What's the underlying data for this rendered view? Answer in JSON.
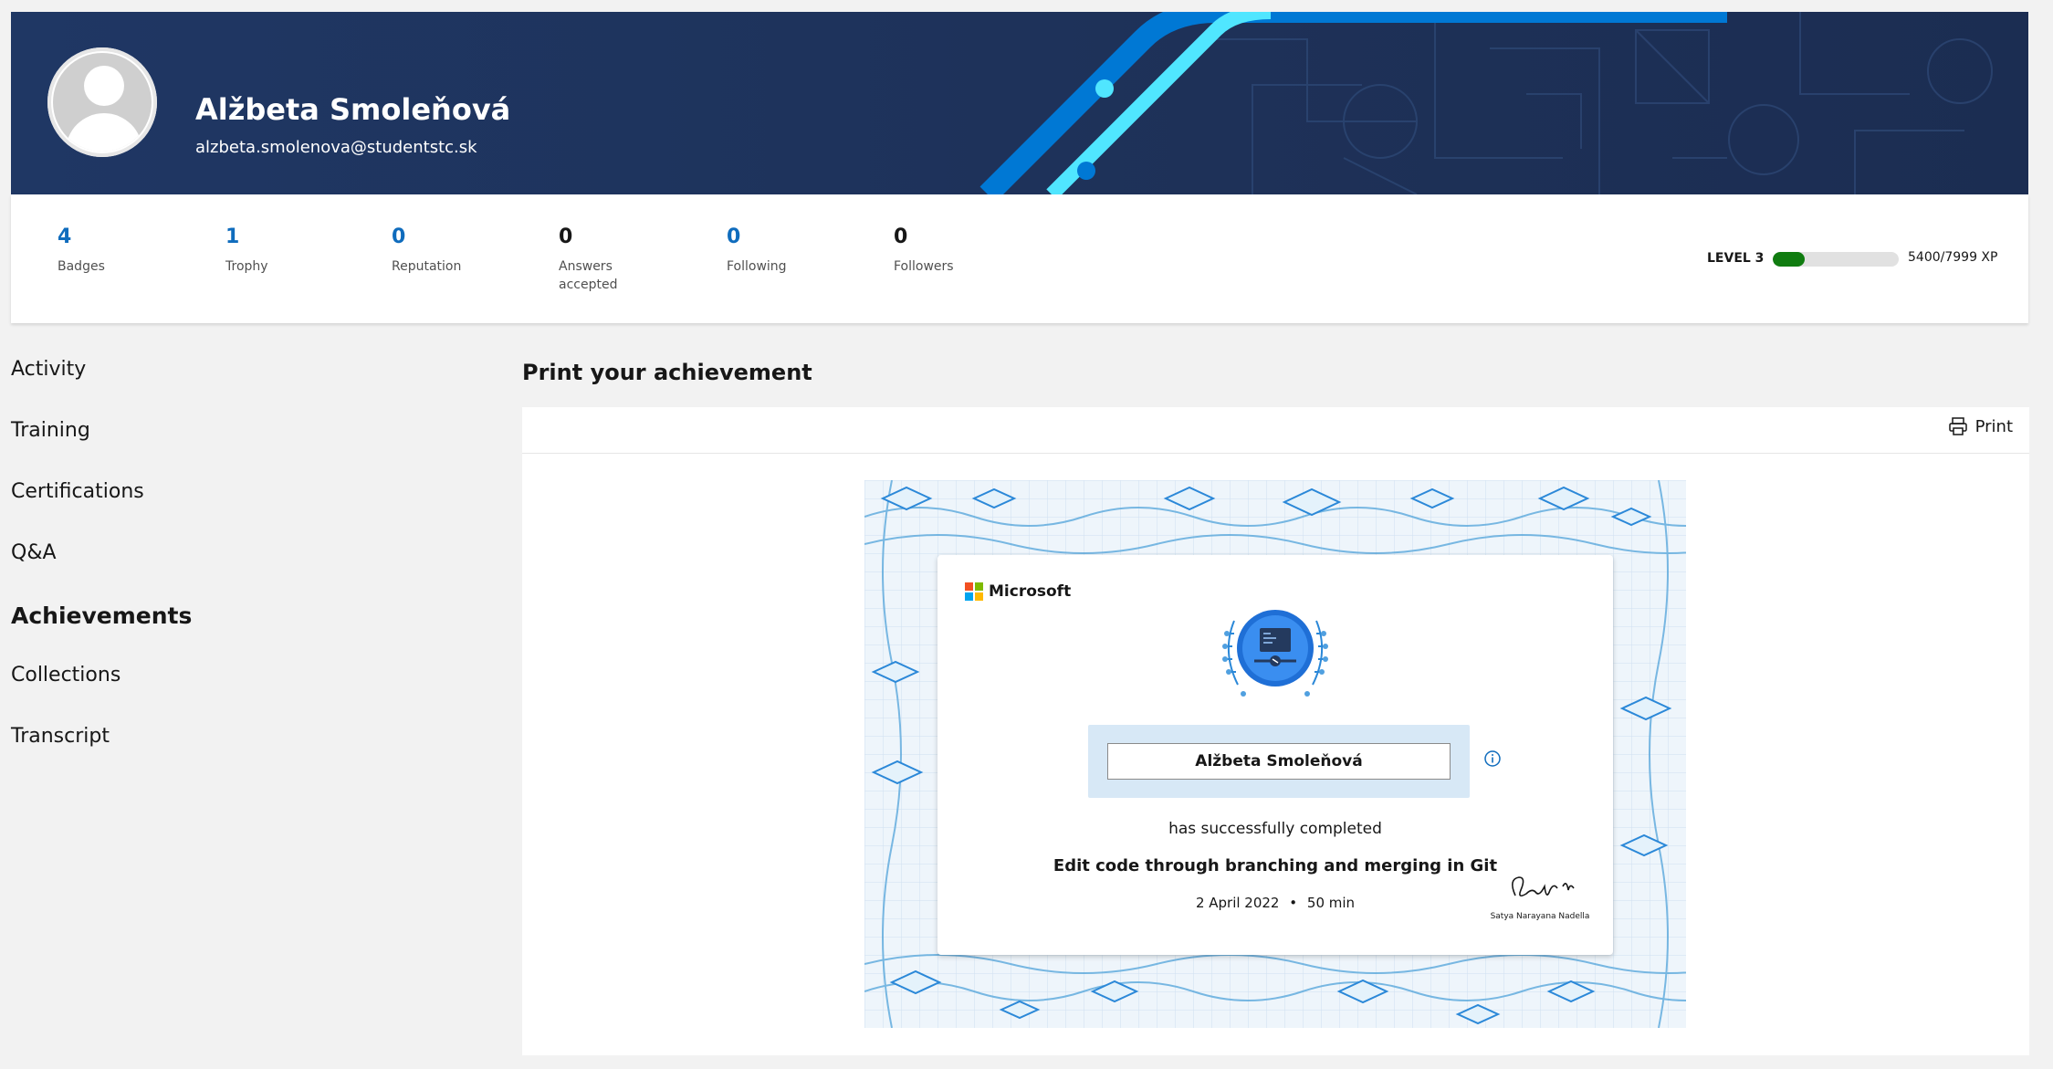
{
  "profile": {
    "name": "Alžbeta Smoleňová",
    "email": "alzbeta.smolenova@studentstc.sk"
  },
  "stats": [
    {
      "value": "4",
      "label": "Badges"
    },
    {
      "value": "1",
      "label": "Trophy"
    },
    {
      "value": "0",
      "label": "Reputation"
    },
    {
      "value": "0",
      "label": "Answers accepted"
    },
    {
      "value": "0",
      "label": "Following"
    },
    {
      "value": "0",
      "label": "Followers"
    }
  ],
  "level": {
    "label": "LEVEL 3",
    "xp_text": "5400/7999 XP",
    "progress_fraction": 0.25,
    "bar_color": "#107c10"
  },
  "nav": {
    "items": [
      "Activity",
      "Training",
      "Certifications",
      "Q&A",
      "Achievements",
      "Collections",
      "Transcript"
    ],
    "active": "Achievements"
  },
  "main": {
    "title": "Print your achievement",
    "print_label": "Print"
  },
  "certificate": {
    "brand": "Microsoft",
    "recipient": "Alžbeta Smoleňová",
    "completed_text": "has successfully completed",
    "course": "Edit code through branching and merging in Git",
    "date": "2 April 2022",
    "separator": "•",
    "duration": "50 min",
    "signatory": "Satya Narayana Nadella"
  },
  "colors": {
    "banner": "#1f3764",
    "accent_blue": "#0f6cbd",
    "cyan_stripe": "#50e6ff",
    "blue_stripe": "#0078d4"
  },
  "icons": {
    "print": "printer-icon",
    "info": "info-icon",
    "avatar": "person-icon"
  }
}
